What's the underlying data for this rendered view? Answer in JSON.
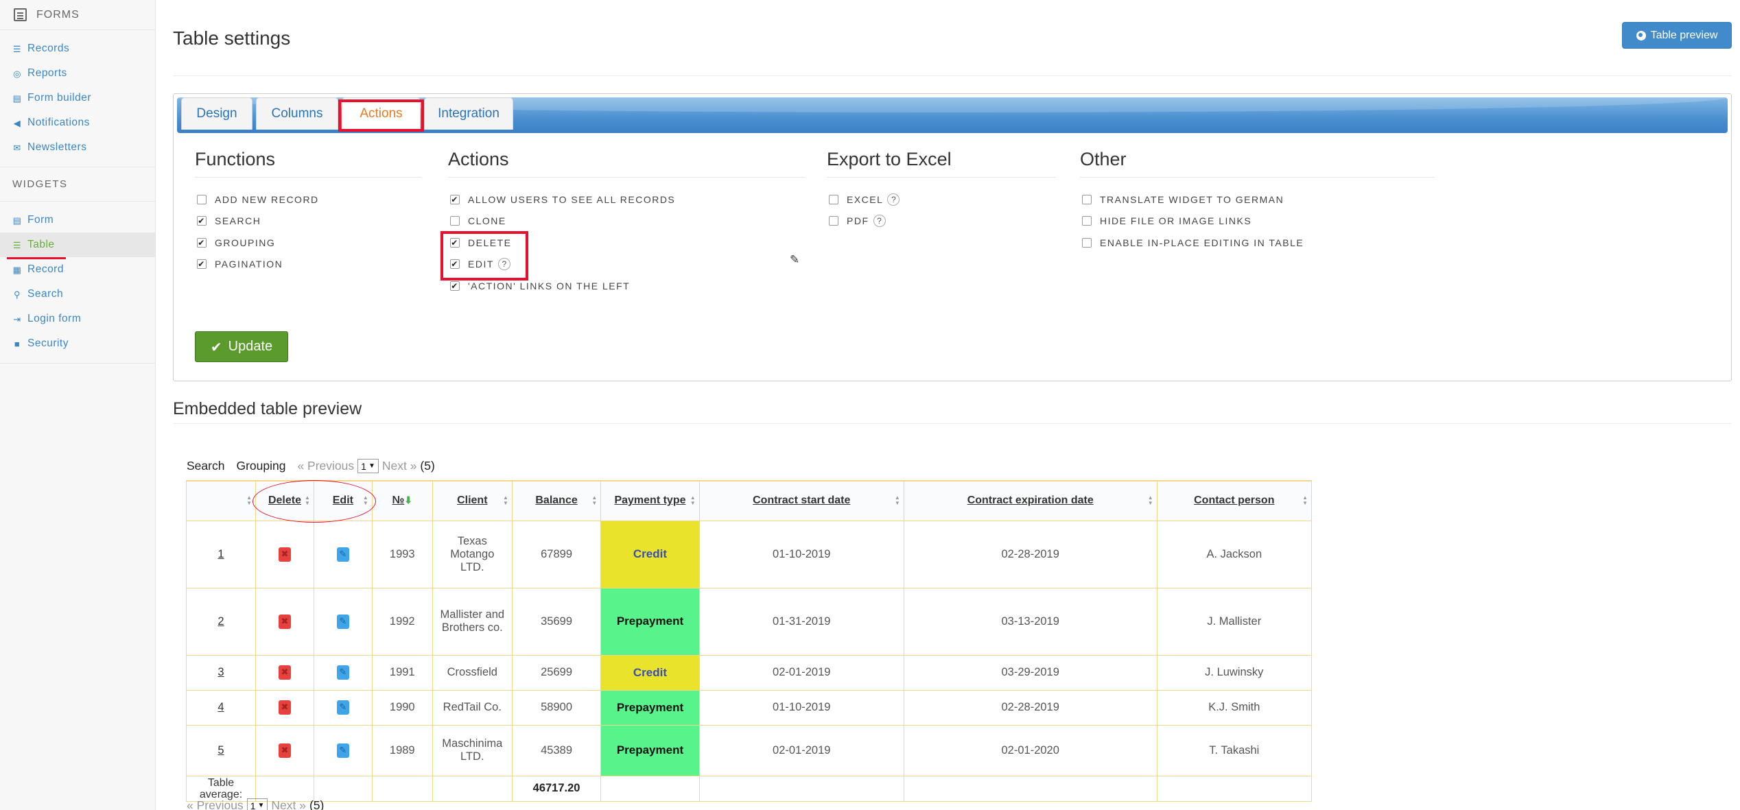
{
  "sidebar": {
    "header": "FORMS",
    "forms_items": [
      {
        "label": "Records",
        "icon": "list-icon"
      },
      {
        "label": "Reports",
        "icon": "target-icon"
      },
      {
        "label": "Form builder",
        "icon": "form-icon"
      },
      {
        "label": "Notifications",
        "icon": "bullhorn-icon"
      },
      {
        "label": "Newsletters",
        "icon": "envelope-icon"
      }
    ],
    "widgets_header": "WIDGETS",
    "widget_items": [
      {
        "label": "Form",
        "icon": "form-icon"
      },
      {
        "label": "Table",
        "icon": "list-icon",
        "active": true
      },
      {
        "label": "Record",
        "icon": "document-icon"
      },
      {
        "label": "Search",
        "icon": "search-icon"
      },
      {
        "label": "Login form",
        "icon": "login-icon"
      },
      {
        "label": "Security",
        "icon": "lock-icon"
      }
    ]
  },
  "page": {
    "title": "Table settings",
    "preview_button": "Table preview"
  },
  "tabs": [
    {
      "label": "Design"
    },
    {
      "label": "Columns"
    },
    {
      "label": "Actions",
      "active": true
    },
    {
      "label": "Integration"
    }
  ],
  "functions": {
    "title": "Functions",
    "options": [
      {
        "label": "ADD NEW RECORD",
        "checked": false
      },
      {
        "label": "SEARCH",
        "checked": true
      },
      {
        "label": "GROUPING",
        "checked": true
      },
      {
        "label": "PAGINATION",
        "checked": true
      }
    ]
  },
  "actions": {
    "title": "Actions",
    "options": [
      {
        "label": "ALLOW USERS TO SEE ALL RECORDS",
        "checked": true
      },
      {
        "label": "CLONE",
        "checked": false
      },
      {
        "label": "DELETE",
        "checked": true
      },
      {
        "label": "EDIT",
        "checked": true,
        "help": "?"
      },
      {
        "label": "'ACTION' LINKS ON THE LEFT",
        "checked": true
      }
    ]
  },
  "export": {
    "title": "Export to Excel",
    "options": [
      {
        "label": "EXCEL",
        "checked": false,
        "help": "?"
      },
      {
        "label": "PDF",
        "checked": false,
        "help": "?"
      }
    ]
  },
  "other": {
    "title": "Other",
    "options": [
      {
        "label": "TRANSLATE WIDGET TO GERMAN",
        "checked": false
      },
      {
        "label": "HIDE FILE OR IMAGE LINKS",
        "checked": false
      },
      {
        "label": "ENABLE IN-PLACE EDITING IN TABLE",
        "checked": false
      }
    ]
  },
  "update_button": "Update",
  "preview": {
    "title": "Embedded table preview",
    "search_link": "Search",
    "grouping_link": "Grouping",
    "prev": "« Previous",
    "next": "Next »",
    "page": "1",
    "count": "(5)",
    "columns": [
      "Delete",
      "Edit",
      "№",
      "Client",
      "Balance",
      "Payment type",
      "Contract start date",
      "Contract expiration date",
      "Contact person"
    ],
    "rows": [
      {
        "idx": "1",
        "no": "1993",
        "client": "Texas Motango LTD.",
        "balance": "67899",
        "payment": "Credit",
        "start": "01-10-2019",
        "end": "02-28-2019",
        "contact": "A. Jackson"
      },
      {
        "idx": "2",
        "no": "1992",
        "client": "Mallister and Brothers co.",
        "balance": "35699",
        "payment": "Prepayment",
        "start": "01-31-2019",
        "end": "03-13-2019",
        "contact": "J. Mallister"
      },
      {
        "idx": "3",
        "no": "1991",
        "client": "Crossfield",
        "balance": "25699",
        "payment": "Credit",
        "start": "02-01-2019",
        "end": "03-29-2019",
        "contact": "J. Luwinsky"
      },
      {
        "idx": "4",
        "no": "1990",
        "client": "RedTail Co.",
        "balance": "58900",
        "payment": "Prepayment",
        "start": "01-10-2019",
        "end": "02-28-2019",
        "contact": "K.J. Smith"
      },
      {
        "idx": "5",
        "no": "1989",
        "client": "Maschinima LTD.",
        "balance": "45389",
        "payment": "Prepayment",
        "start": "02-01-2019",
        "end": "02-01-2020",
        "contact": "T. Takashi"
      }
    ],
    "avg_label": "Table average:",
    "avg_value": "46717.20"
  },
  "colors": {
    "link": "#3a86c4",
    "active_green": "#6aac3c",
    "annotation_red": "#e8102d",
    "credit_bg": "#e9e32b",
    "prepayment_bg": "#58f38a",
    "update_bg": "#5b9b2d",
    "preview_btn_bg": "#428bca"
  }
}
